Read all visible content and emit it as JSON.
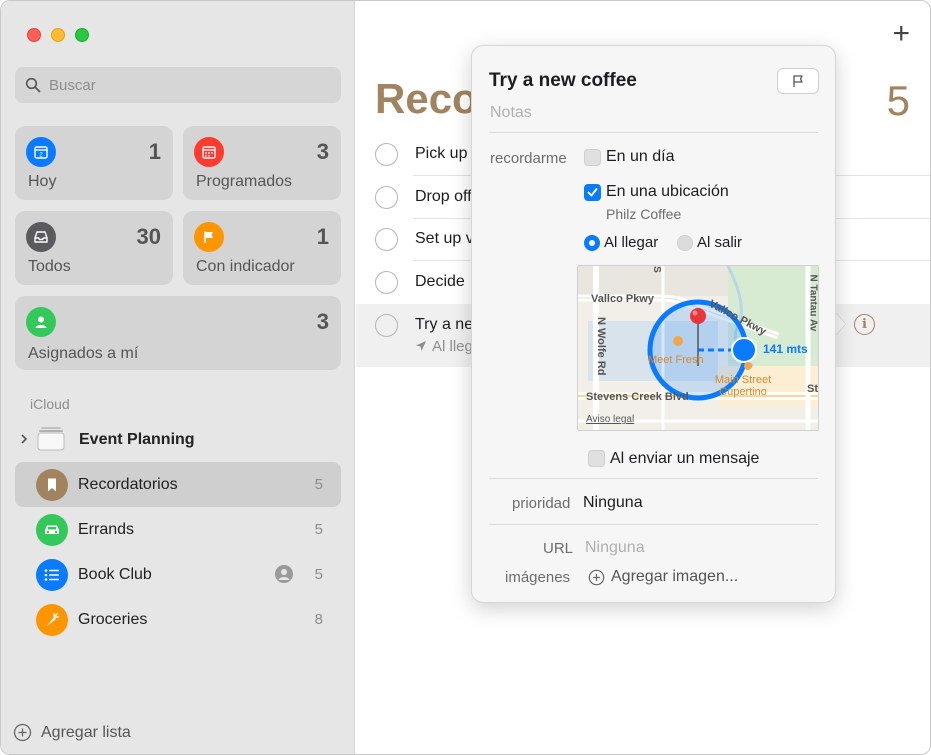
{
  "sidebar": {
    "search": {
      "placeholder": "Buscar"
    },
    "smart_lists": [
      {
        "label": "Hoy",
        "count": "1",
        "color": "#0a7aff",
        "icon": "calendar-today-icon"
      },
      {
        "label": "Programados",
        "count": "3",
        "color": "#ff3b30",
        "icon": "calendar-icon"
      },
      {
        "label": "Todos",
        "count": "30",
        "color": "#5a5a5f",
        "icon": "tray-icon"
      },
      {
        "label": "Con indicador",
        "count": "1",
        "color": "#ff9500",
        "icon": "flag-icon"
      },
      {
        "label": "Asignados a mí",
        "count": "3",
        "color": "#34c759",
        "icon": "person-icon"
      }
    ],
    "section_label": "iCloud",
    "group": {
      "label": "Event Planning"
    },
    "lists": [
      {
        "label": "Recordatorios",
        "count": "5",
        "color": "#a2835f",
        "icon": "bookmark-icon"
      },
      {
        "label": "Errands",
        "count": "5",
        "color": "#34c759",
        "icon": "car-icon"
      },
      {
        "label": "Book Club",
        "count": "5",
        "color": "#0a7aff",
        "icon": "list-icon"
      },
      {
        "label": "Groceries",
        "count": "8",
        "color": "#ff9500",
        "icon": "carrot-icon"
      }
    ],
    "add_list_label": "Agregar lista"
  },
  "main": {
    "title": "Reco",
    "count": "5",
    "add_label": "+",
    "reminders": [
      {
        "text": "Pick up"
      },
      {
        "text": "Drop off"
      },
      {
        "text": "Set up v"
      },
      {
        "text": "Decide"
      },
      {
        "text": "Try a ne",
        "subtitle": "Al lleg"
      }
    ]
  },
  "popover": {
    "title": "Try a new coffee",
    "notes_placeholder": "Notas",
    "remind_label": "recordarme",
    "on_day_label": "En un día",
    "on_day_checked": false,
    "location_label": "En una ubicación",
    "location_checked": true,
    "location_name": "Philz Coffee",
    "arriving_label": "Al llegar",
    "leaving_label": "Al salir",
    "arriving_selected": true,
    "map": {
      "streets": [
        "Vallco Pkwy",
        "N Wolfe Rd",
        "Stevens Creek Blvd",
        "Vallco Pkwy",
        "N Tantau Av",
        "St",
        "S"
      ],
      "places": [
        "Meet Fresh",
        "Main Street Cupertino"
      ],
      "radius_label": "141 mts",
      "legal_label": "Aviso legal"
    },
    "message_label": "Al enviar un mensaje",
    "message_checked": false,
    "priority_label": "prioridad",
    "priority_value": "Ninguna",
    "url_label": "URL",
    "url_placeholder": "Ninguna",
    "images_label": "imágenes",
    "add_image_label": "Agregar imagen..."
  }
}
